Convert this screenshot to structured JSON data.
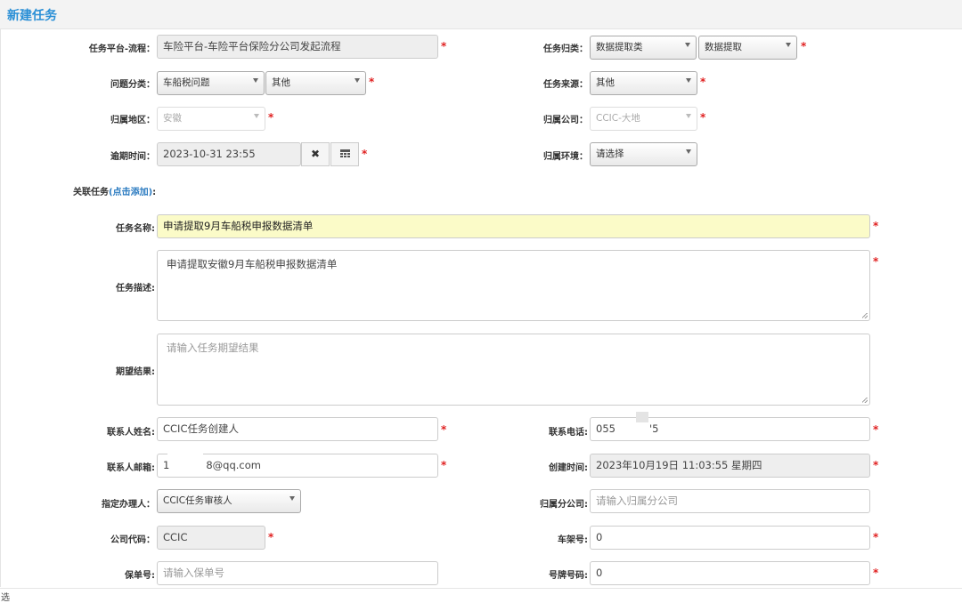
{
  "header": {
    "title": "新建任务"
  },
  "form": {
    "platform_flow": {
      "label": "任务平台-流程：",
      "value": "车险平台-车险平台保险分公司发起流程"
    },
    "task_category": {
      "label": "任务归类：",
      "value1": "数据提取类",
      "value2": "数据提取"
    },
    "issue_category": {
      "label": "问题分类：",
      "value1": "车船税问题",
      "value2": "其他"
    },
    "task_source": {
      "label": "任务来源：",
      "value": "其他"
    },
    "region": {
      "label": "归属地区：",
      "value": "安徽"
    },
    "company": {
      "label": "归属公司：",
      "value": "CCIC-大地"
    },
    "due_time": {
      "label": "逾期时间：",
      "value": "2023-10-31 23:55",
      "clear_glyph": "✖"
    },
    "environment": {
      "label": "归属环境：",
      "value": "请选择"
    },
    "related_task": {
      "label": "关联任务",
      "link": "(点击添加)",
      "suffix": ":"
    },
    "task_name": {
      "label": "任务名称:",
      "value": "申请提取9月车船税申报数据清单"
    },
    "task_desc": {
      "label": "任务描述:",
      "value": "申请提取安徽9月车船税申报数据清单"
    },
    "expected_result": {
      "label": "期望结果:",
      "placeholder": "请输入任务期望结果"
    },
    "contact_name": {
      "label": "联系人姓名:",
      "value": "CCIC任务创建人"
    },
    "contact_phone": {
      "label": "联系电话:",
      "value_start": "055",
      "value_end": "'5"
    },
    "contact_email": {
      "label": "联系人邮箱:",
      "value_start": "1",
      "value_end": "8@qq.com"
    },
    "created_time": {
      "label": "创建时间:",
      "value": "2023年10月19日 11:03:55 星期四"
    },
    "assignee": {
      "label": "指定办理人：",
      "value": "CCIC任务审核人"
    },
    "branch": {
      "label": "归属分公司:",
      "placeholder": "请输入归属分公司"
    },
    "company_code": {
      "label": "公司代码：",
      "value": "CCIC"
    },
    "vin": {
      "label": "车架号:",
      "value": "0"
    },
    "policy_no": {
      "label": "保单号:",
      "placeholder": "请输入保单号"
    },
    "plate_no": {
      "label": "号牌号码:",
      "value": "0"
    },
    "required_mark": "*"
  },
  "status": {
    "text": "选"
  }
}
